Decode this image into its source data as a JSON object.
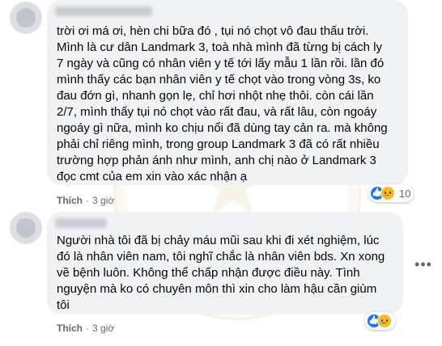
{
  "comments": [
    {
      "text_lines": [
        "trời ơi má ơi, hèn chi bữa đó , tụi nó chọt vô đau thấu trời.",
        "Mình là cư dân Landmark 3, toà nhà mình đã từng bị cách ly",
        "7 ngày và cũng có nhân viên y tế tới lấy mẫu 1 lần rồi. lần đó",
        "mình thấy các bạn nhân viên y tế chọt vào trong vòng 3s, ko",
        "đau đớn gì, nhanh gọn lẹ, chỉ hơi nhột nhẹ thôi. còn cái lần",
        "2/7, mình thấy tụi nó chọt vào rất đau, và rất lâu, còn ngoáy",
        "ngoáy gì nữa, mình ko chịu nổi đã dùng tay cản ra. mà không",
        "phải chỉ riêng mình, trong group Landmark 3 đã có rất nhiều",
        "trường hợp phản ánh như mình, anh chị nào ở Landmark 3",
        "đọc cmt của em xin vào xác nhận ạ"
      ],
      "like_label": "Thích",
      "time": "3 giờ",
      "reaction_count": "10",
      "reaction_icons": [
        "like",
        "sad"
      ]
    },
    {
      "text_lines": [
        "Người nhà tôi đã bị chảy máu mũi sau khi đi xét nghiệm, lúc",
        "đó là nhân viên nam, tôi nghĩ chắc là nhân viên bds. Xn xong",
        "về bệnh luôn. Không thể chấp nhận được điều này. Tình",
        "nguyện mà ko có chuyên môn thì xin cho làm hậu cần giùm",
        "tôi"
      ],
      "like_label": "Thích",
      "time": "3 giờ",
      "reaction_count": "",
      "reaction_icons": [
        "like",
        "sad"
      ],
      "more_icon": "more-horizontal-icon"
    }
  ],
  "separator": "·"
}
